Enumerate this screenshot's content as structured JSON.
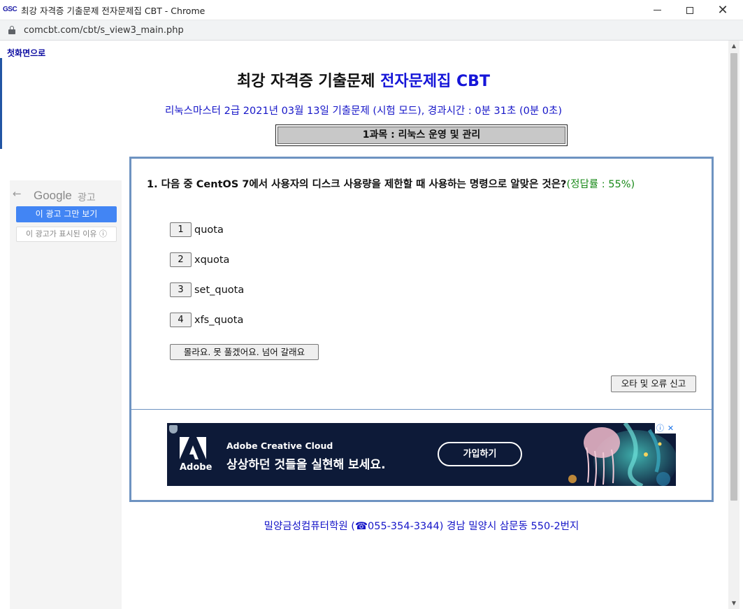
{
  "window": {
    "favicon_text": "GSC",
    "title": "최강 자격증 기출문제 전자문제집 CBT - Chrome",
    "url": "comcbt.com/cbt/s_view3_main.php"
  },
  "nav": {
    "home_link": "첫화면으로"
  },
  "header": {
    "title_prefix": "최강 자격증 기출문제 ",
    "title_highlight": "전자문제집 CBT",
    "exam_info": "리눅스마스터 2급 2021년 03월 13일 기출문제 (시험 모드), 경과시간 : 0분 31초 (0분 0초)",
    "subject": "1과목 : 리눅스 운영 및 관리"
  },
  "side_ad": {
    "back_icon": "←",
    "brand": "Google",
    "label": "광고",
    "stop_button": "이 광고 그만 보기",
    "why_button": "이 광고가 표시된 이유 ⓘ"
  },
  "question": {
    "number": "1.",
    "text": "다음 중 CentOS 7에서 사용자의 디스크 사용량을 제한할 때 사용하는 명령으로 알맞은 것은?",
    "accuracy": "(정답률 : 55%)",
    "options": [
      {
        "num": "1",
        "text": "quota"
      },
      {
        "num": "2",
        "text": "xquota"
      },
      {
        "num": "3",
        "text": "set_quota"
      },
      {
        "num": "4",
        "text": "xfs_quota"
      }
    ],
    "skip_button": "몰라요. 못 풀겠어요. 넘어 갈래요",
    "report_button": "오타 및 오류 신고"
  },
  "banner_ad": {
    "logo_text": "Adobe",
    "product": "Adobe Creative Cloud",
    "slogan": "상상하던 것들을 실현해 보세요.",
    "cta": "가입하기",
    "info_icon": "ⓘ",
    "close_icon": "✕"
  },
  "footer": {
    "text": "밀양금성컴퓨터학원 (☎055-354-3344) 경남 밀양시 삼문동 550-2번지"
  },
  "colors": {
    "accent_blue": "#1515d8",
    "box_border": "#6e93c1",
    "accuracy_green": "#1a8a1a",
    "google_blue": "#4285f4"
  }
}
